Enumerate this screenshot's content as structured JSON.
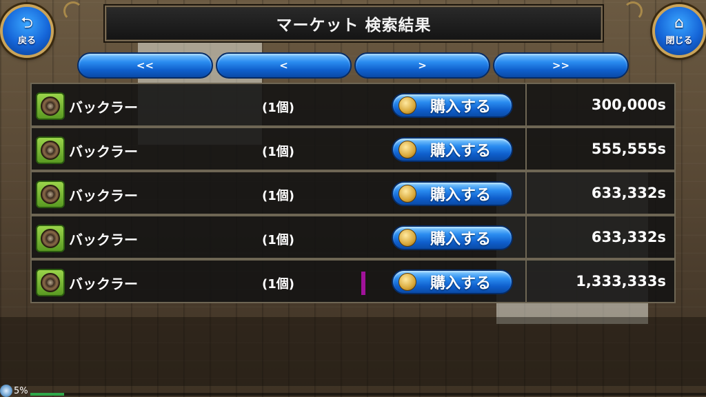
{
  "header": {
    "title": "マーケット 検索結果",
    "back_label": "戻る",
    "close_label": "閉じる"
  },
  "pagination": {
    "first": "<<",
    "prev": "<",
    "next": ">",
    "last": ">>"
  },
  "listings": [
    {
      "name": "バックラー",
      "quantity": "(1個)",
      "buy_label": "購入する",
      "price": "300,000s"
    },
    {
      "name": "バックラー",
      "quantity": "(1個)",
      "buy_label": "購入する",
      "price": "555,555s"
    },
    {
      "name": "バックラー",
      "quantity": "(1個)",
      "buy_label": "購入する",
      "price": "633,332s"
    },
    {
      "name": "バックラー",
      "quantity": "(1個)",
      "buy_label": "購入する",
      "price": "633,332s"
    },
    {
      "name": "バックラー",
      "quantity": "(1個)",
      "buy_label": "購入する",
      "price": "1,333,333s"
    }
  ],
  "status": {
    "percent_text": "5%",
    "progress": 0.05
  },
  "colors": {
    "button_blue": "#2a8cf0",
    "frame_gold": "#caa45a",
    "item_icon_green": "#5a9a22",
    "marker_purple": "#a0129a"
  },
  "icons": {
    "back": "back-arrow-icon",
    "close": "home-icon",
    "item": "buckler-shield-icon",
    "buy": "coin-icon"
  }
}
